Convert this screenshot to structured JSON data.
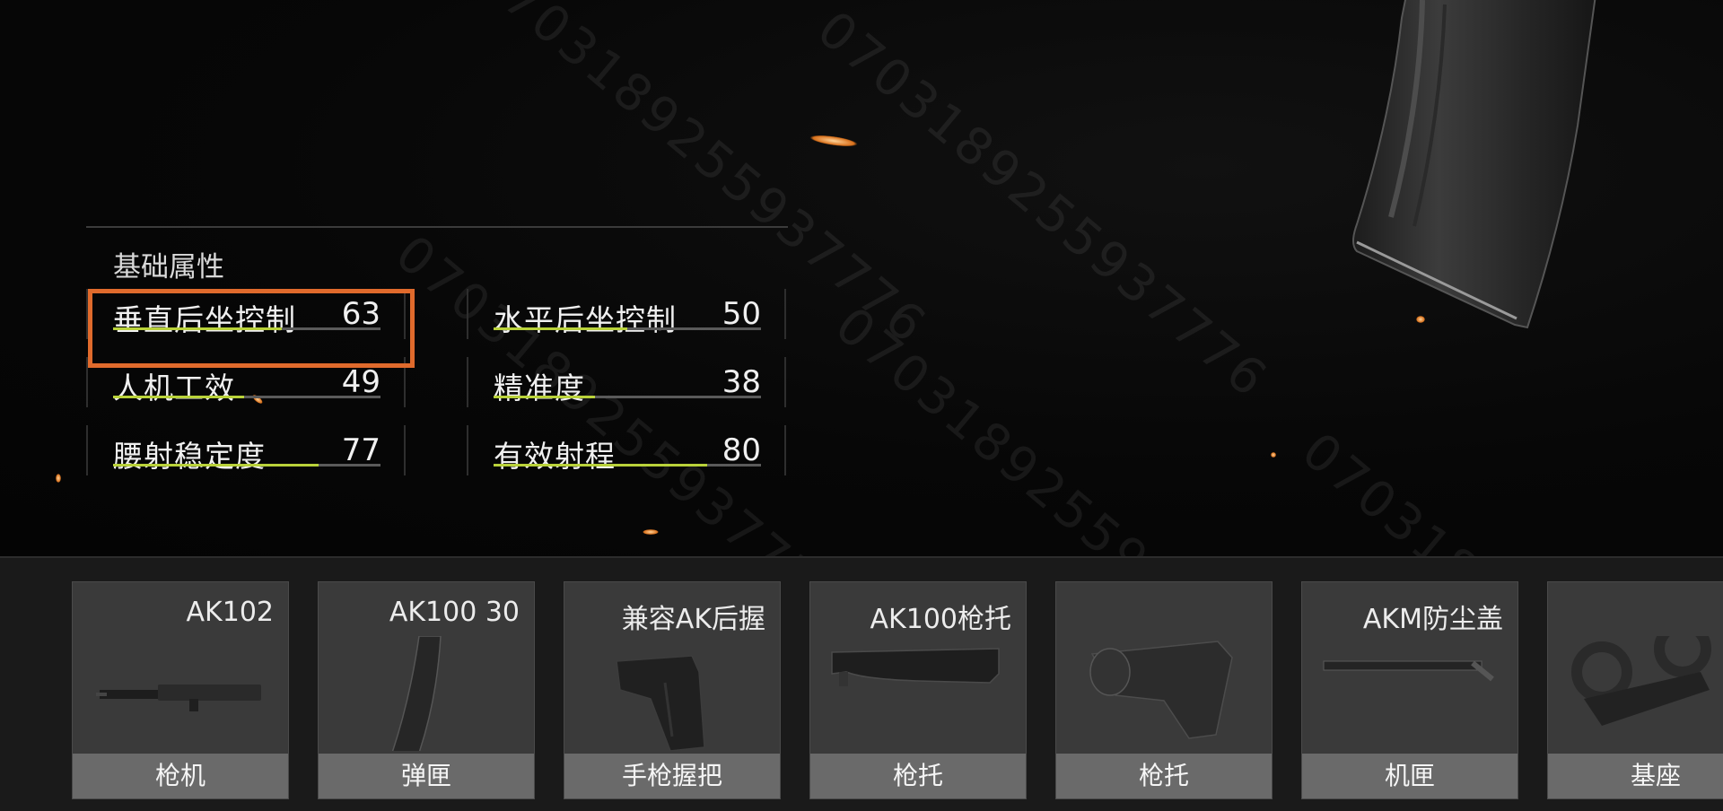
{
  "watermark": "0703189255937776",
  "stats_panel": {
    "title": "基础属性",
    "stats": [
      {
        "label": "垂直后坐控制",
        "value": "63",
        "level": 0.63
      },
      {
        "label": "水平后坐控制",
        "value": "50",
        "level": 0.5
      },
      {
        "label": "人机工效",
        "value": "49",
        "level": 0.49
      },
      {
        "label": "精准度",
        "value": "38",
        "level": 0.38
      },
      {
        "label": "腰射稳定度",
        "value": "77",
        "level": 0.77
      },
      {
        "label": "有效射程",
        "value": "80",
        "level": 0.8
      }
    ],
    "highlight_color": "#e06a2c",
    "bar_color": "#b9d23a"
  },
  "parts": [
    {
      "name": "AK102",
      "type": "枪机",
      "icon": "receiver-icon"
    },
    {
      "name": "AK100 30",
      "type": "弹匣",
      "icon": "magazine-icon"
    },
    {
      "name": "兼容AK后握",
      "type": "手枪握把",
      "icon": "pistol-grip-icon"
    },
    {
      "name": "AK100枪托",
      "type": "枪托",
      "icon": "folding-stock-icon"
    },
    {
      "name": "",
      "type": "枪托",
      "icon": "stock-icon"
    },
    {
      "name": "AKM防尘盖",
      "type": "机匣",
      "icon": "dust-cover-icon"
    },
    {
      "name": "",
      "type": "基座",
      "icon": "scope-mount-icon"
    }
  ]
}
